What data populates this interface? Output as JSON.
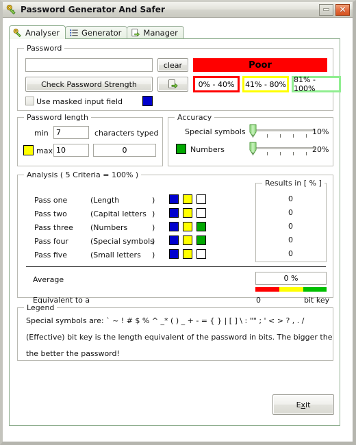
{
  "window": {
    "title": "Password Generator And Safer",
    "icon": "key-icon",
    "minimize_label": "Minimize",
    "close_label": "Close"
  },
  "tabs": [
    {
      "label": "Analyser",
      "icon": "key-icon",
      "active": true
    },
    {
      "label": "Generator",
      "icon": "list-icon",
      "active": false
    },
    {
      "label": "Manager",
      "icon": "page-arrow-icon",
      "active": false
    }
  ],
  "password_group": {
    "title": "Password",
    "password_value": "",
    "password_placeholder": "",
    "clear_label": "clear",
    "check_label": "Check Password Strength",
    "transfer_icon": "page-arrow-icon",
    "masked_label": "Use masked input field",
    "masked_checked": false,
    "masked_color": "#0000cd",
    "strength_label": "Poor",
    "strength_color": "#ff0000",
    "ranges": [
      {
        "label": "0% - 40%",
        "color": "#ff0000"
      },
      {
        "label": "41% - 80%",
        "color": "#ffff00"
      },
      {
        "label": "81% - 100%",
        "color": "#90ee90"
      }
    ]
  },
  "length_group": {
    "title": "Password length",
    "min_label": "min",
    "min_value": "7",
    "max_label": "max",
    "max_value": "10",
    "max_color": "#ffff00",
    "typed_label": "characters typed",
    "typed_value": "0"
  },
  "accuracy_group": {
    "title": "Accuracy",
    "rows": [
      {
        "label": "Special symbols",
        "value": "10%",
        "color": null,
        "slider_pos": 0
      },
      {
        "label": "Numbers",
        "value": "20%",
        "color": "#00a800",
        "slider_pos": 0
      }
    ]
  },
  "analysis_group": {
    "title": "Analysis ( 5 Criteria = 100% )",
    "results_title": "Results in [ % ]",
    "rows": [
      {
        "pass": "Pass one",
        "criteria": "(Length",
        "paren": ")",
        "colors": [
          "#0000cd",
          "#ffff00",
          "#ffffff"
        ],
        "result": "0"
      },
      {
        "pass": "Pass two",
        "criteria": "(Capital letters",
        "paren": ")",
        "colors": [
          "#0000cd",
          "#ffff00",
          "#ffffff"
        ],
        "result": "0"
      },
      {
        "pass": "Pass three",
        "criteria": "(Numbers",
        "paren": ")",
        "colors": [
          "#0000cd",
          "#ffff00",
          "#00a800"
        ],
        "result": "0"
      },
      {
        "pass": "Pass four",
        "criteria": "(Special symbols",
        "paren": ")",
        "colors": [
          "#0000cd",
          "#ffff00",
          "#00a800"
        ],
        "result": "0"
      },
      {
        "pass": "Pass five",
        "criteria": "(Small letters",
        "paren": ")",
        "colors": [
          "#0000cd",
          "#ffff00",
          "#ffffff"
        ],
        "result": "0"
      }
    ],
    "average_label": "Average",
    "average_value": "0 %",
    "equivalent_label": "Equivalent to a",
    "equivalent_value": "0",
    "equivalent_unit": "bit key",
    "gradient": [
      "#ff0000",
      "#ffff00",
      "#00c000"
    ]
  },
  "legend_group": {
    "title": "Legend",
    "line1": "Special symbols are: ` ~ ! # $ % ^ _* ( ) _ + - = { } | [ ] \\ : \"\" ; ' < > ? , . /",
    "line2": "(Effective) bit key is the length equivalent of the password in bits. The bigger the key,",
    "line3": "the better the password!"
  },
  "footer": {
    "exit_label": "Exit",
    "exit_mnemonic": "x"
  }
}
